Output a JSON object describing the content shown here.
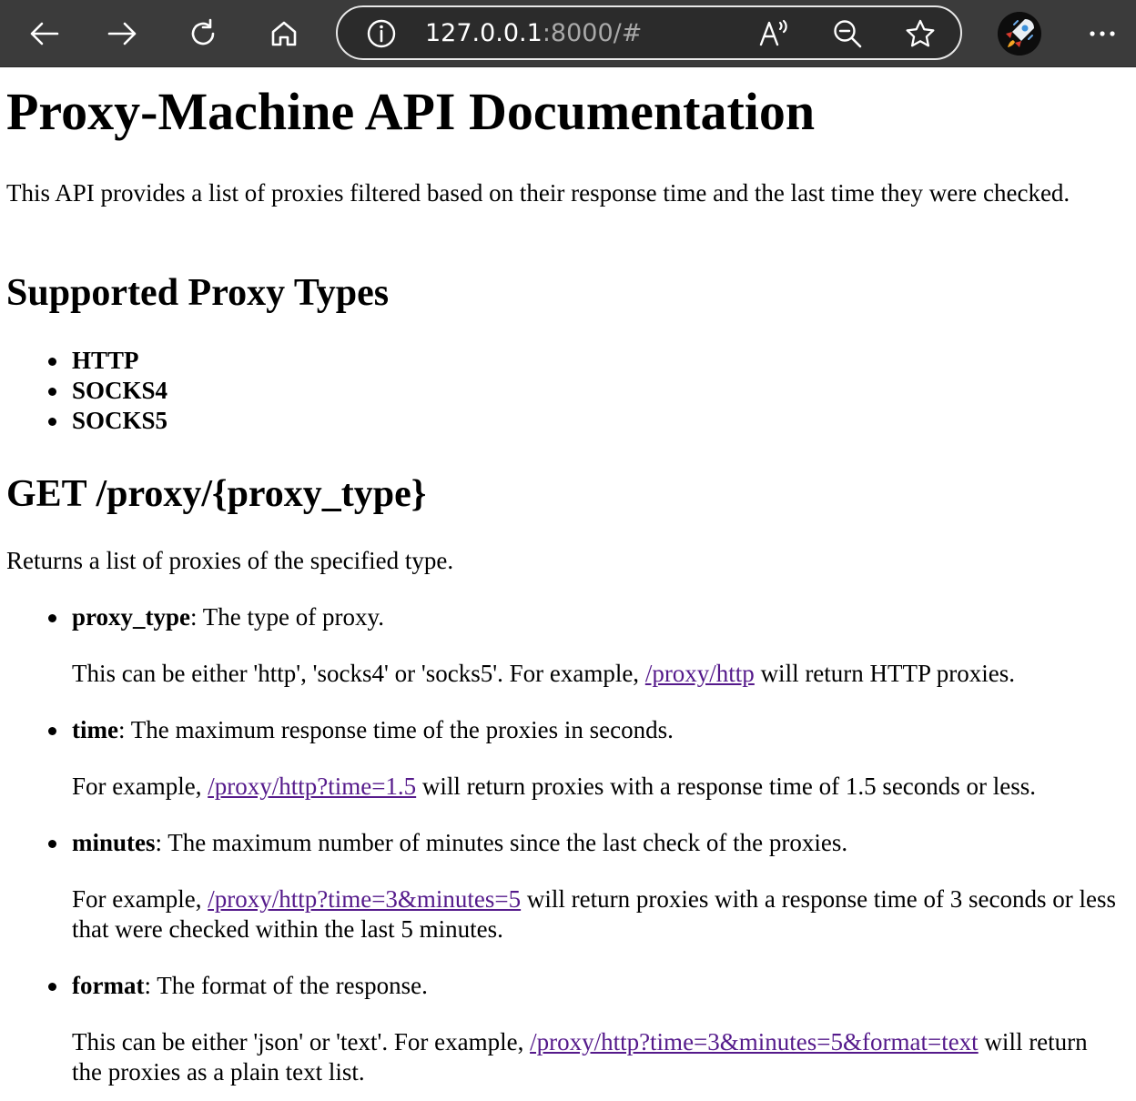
{
  "browser": {
    "url_host": "127.0.0.1",
    "url_rest": ":8000/#",
    "icons": {
      "back": "arrow-left-icon",
      "forward": "arrow-right-icon",
      "refresh": "refresh-icon",
      "home": "home-icon",
      "info": "info-icon",
      "read_aloud": "read-aloud-icon",
      "zoom_out": "zoom-out-icon",
      "favorite": "star-icon",
      "profile": "rocket-avatar",
      "menu": "more-icon"
    }
  },
  "page": {
    "title": "Proxy-Machine API Documentation",
    "intro": "This API provides a list of proxies filtered based on their response time and the last time they were checked.",
    "types_heading": "Supported Proxy Types",
    "types": [
      "HTTP",
      "SOCKS4",
      "SOCKS5"
    ],
    "endpoint_heading": "GET /proxy/{proxy_type}",
    "endpoint_desc": "Returns a list of proxies of the specified type.",
    "params": [
      {
        "name": "proxy_type",
        "summary": ": The type of proxy.",
        "detail_pre": "This can be either 'http', 'socks4' or 'socks5'. For example, ",
        "link": "/proxy/http",
        "detail_post": " will return HTTP proxies."
      },
      {
        "name": "time",
        "summary": ": The maximum response time of the proxies in seconds.",
        "detail_pre": "For example, ",
        "link": "/proxy/http?time=1.5",
        "detail_post": " will return proxies with a response time of 1.5 seconds or less."
      },
      {
        "name": "minutes",
        "summary": ": The maximum number of minutes since the last check of the proxies.",
        "detail_pre": "For example, ",
        "link": "/proxy/http?time=3&minutes=5",
        "detail_post": " will return proxies with a response time of 3 seconds or less that were checked within the last 5 minutes."
      },
      {
        "name": "format",
        "summary": ": The format of the response.",
        "detail_pre": "This can be either 'json' or 'text'. For example, ",
        "link": "/proxy/http?time=3&minutes=5&format=text",
        "detail_post": " will return the proxies as a plain text list."
      }
    ]
  },
  "colors": {
    "toolbar": "#3b3b3b",
    "link_visited": "#551a8b"
  }
}
